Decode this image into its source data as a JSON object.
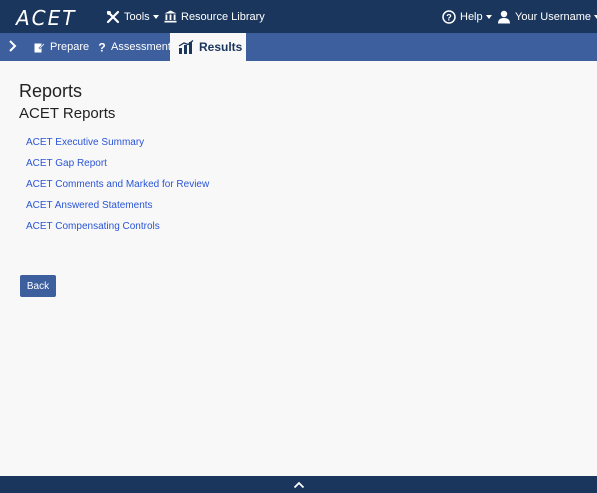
{
  "header": {
    "logo": "ACET",
    "tools_label": "Tools",
    "resource_library_label": "Resource Library",
    "help_label": "Help",
    "username_label": "Your Username"
  },
  "tabs": {
    "prepare_label": "Prepare",
    "assessment_label": "Assessment",
    "results_label": "Results",
    "active": "Results"
  },
  "main": {
    "title": "Reports",
    "section_title": "ACET Reports",
    "reports": [
      "ACET Executive Summary",
      "ACET Gap Report",
      "ACET Comments and Marked for Review",
      "ACET Answered Statements",
      "ACET Compensating Controls"
    ],
    "back_label": "Back"
  },
  "colors": {
    "navbar": "#1b365d",
    "tabbar": "#3d5f9e",
    "link": "#2a55d6",
    "background": "#f8f8f8"
  }
}
